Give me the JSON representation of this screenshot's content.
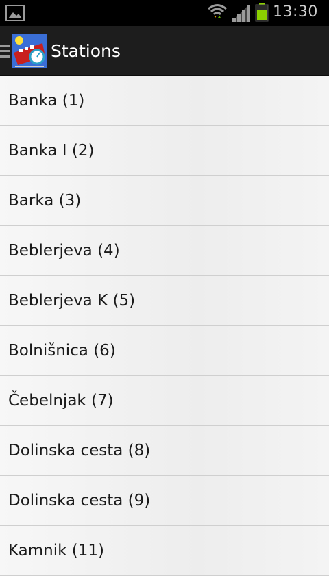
{
  "status_bar": {
    "time": "13:30",
    "icons": [
      "gallery-icon",
      "wifi-icon",
      "signal-icon",
      "battery-icon"
    ],
    "battery_color": "#8bd000"
  },
  "action_bar": {
    "title": "Stations",
    "icons": [
      "drawer-icon",
      "app-logo"
    ]
  },
  "stations": [
    "Banka (1)",
    "Banka I (2)",
    "Barka (3)",
    "Beblerjeva (4)",
    "Beblerjeva K (5)",
    "Bolnišnica (6)",
    "Čebelnjak (7)",
    "Dolinska cesta (8)",
    "Dolinska cesta (9)",
    "Kamnik (11)"
  ]
}
